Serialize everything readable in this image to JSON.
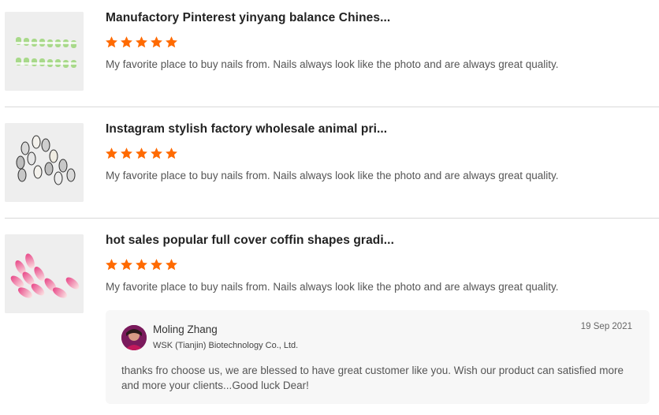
{
  "reviews": [
    {
      "title": "Manufactory Pinterest yinyang balance Chines...",
      "rating": 5,
      "text": "My favorite place to buy nails from. Nails always look like the photo and are always great quality."
    },
    {
      "title": "Instagram stylish factory wholesale animal pri...",
      "rating": 5,
      "text": "My favorite place to buy nails from. Nails always look like the photo and are always great quality."
    },
    {
      "title": "hot sales popular full cover coffin shapes gradi...",
      "rating": 5,
      "text": "My favorite place to buy nails from. Nails always look like the photo and are always great quality."
    }
  ],
  "reply": {
    "name": "Moling Zhang",
    "company": "WSK (Tianjin) Biotechnology Co., Ltd.",
    "date": "19 Sep 2021",
    "text": "thanks fro choose us, we are blessed to have great customer like you. Wish our product can satisfied more and more your clients...Good luck  Dear!"
  },
  "colors": {
    "star": "#ff6a00",
    "reply_bg": "#f7f7f7",
    "divider": "#d9d9d9"
  },
  "icons": {
    "rating": "star-icon",
    "avatar": "user-avatar"
  }
}
